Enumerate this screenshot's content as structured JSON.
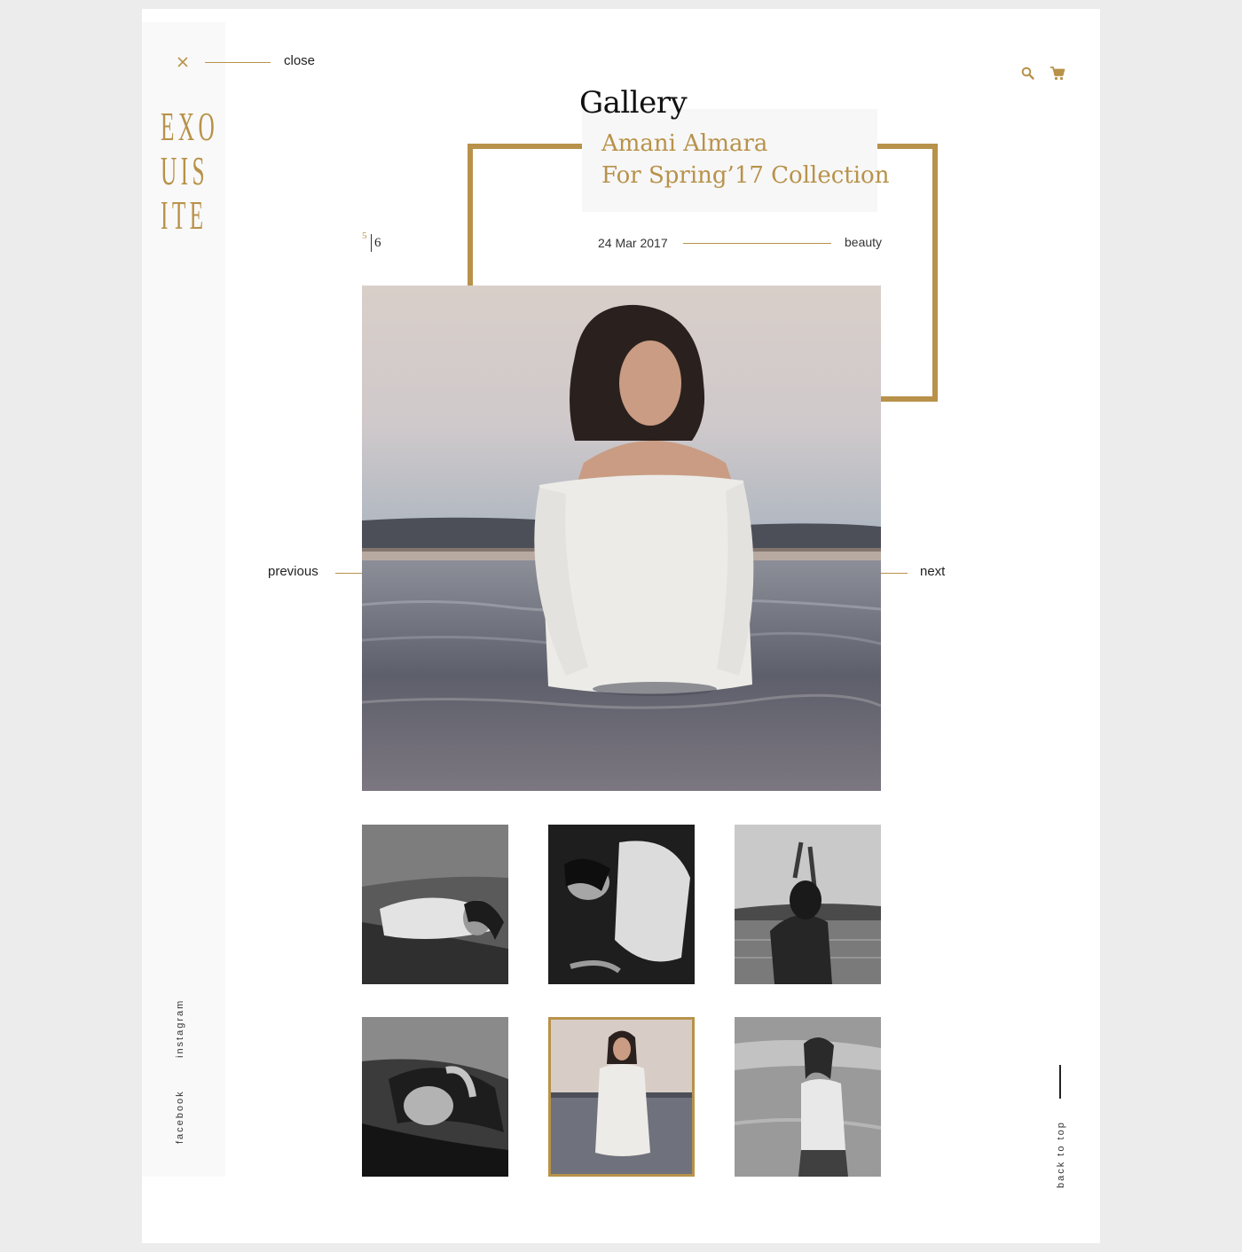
{
  "header": {
    "close_label": "close",
    "search_icon": "search-icon",
    "cart_icon": "cart-icon"
  },
  "logo": {
    "rows": [
      "EXO",
      "UIS",
      "ITE"
    ]
  },
  "social": {
    "instagram": "instagram",
    "facebook": "facebook"
  },
  "page": {
    "title": "Gallery"
  },
  "article": {
    "title_line1": "Amani Almara",
    "title_line2": "For Spring’17 Collection",
    "date": "24 Mar 2017",
    "tag": "beauty"
  },
  "counter": {
    "current": "5",
    "total": "6"
  },
  "nav": {
    "previous": "previous",
    "next": "next"
  },
  "thumbnails": {
    "active_index": 4,
    "count": 6
  },
  "footer": {
    "back_to_top": "back to top"
  },
  "colors": {
    "accent": "#b8924a",
    "background": "#ececec",
    "page": "#ffffff",
    "sidebar": "#f9f9f9"
  }
}
